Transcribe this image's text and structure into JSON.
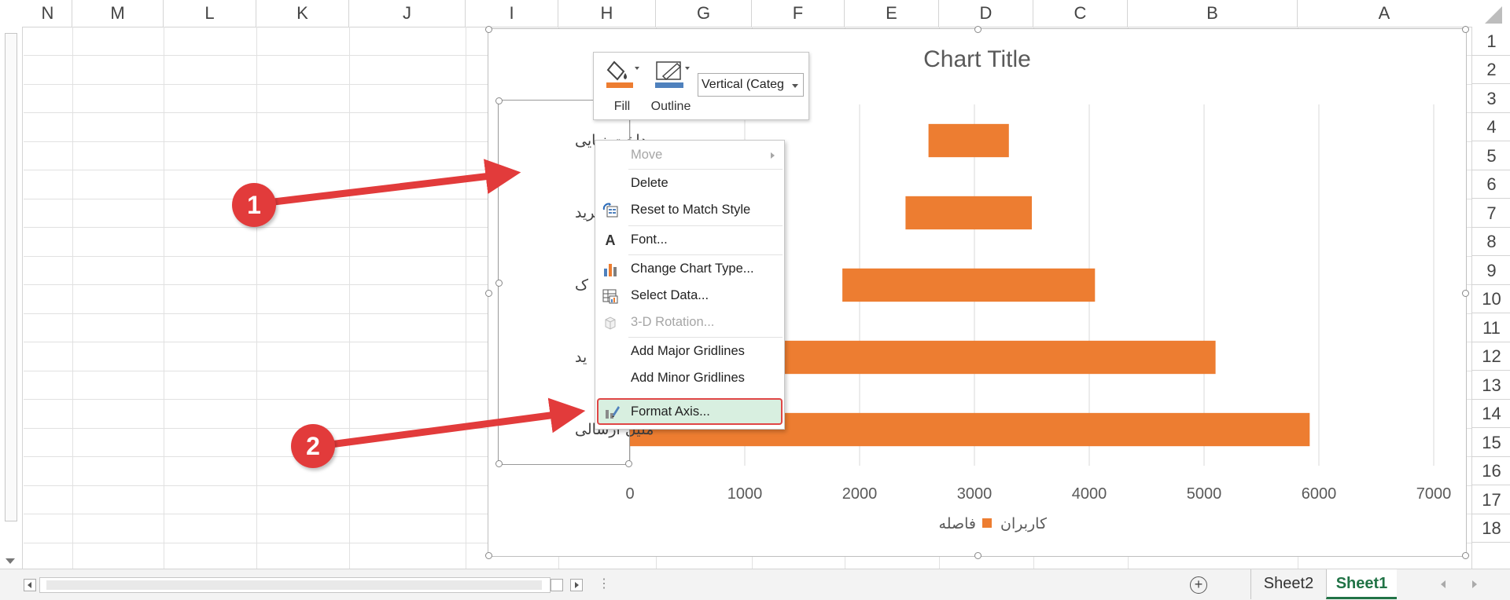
{
  "columns": [
    "N",
    "M",
    "L",
    "K",
    "J",
    "I",
    "H",
    "G",
    "F",
    "E",
    "D",
    "C",
    "B",
    "A"
  ],
  "rows": [
    "1",
    "2",
    "3",
    "4",
    "5",
    "6",
    "7",
    "8",
    "9",
    "10",
    "11",
    "12",
    "13",
    "14",
    "15",
    "16",
    "17",
    "18"
  ],
  "chart": {
    "title": "Chart Title",
    "legend": [
      {
        "label": "کاربران"
      },
      {
        "label": "فاصله"
      }
    ],
    "category_labels_visible": [
      "پرداخت نهایی",
      "ردن به سبد خرید",
      "ک",
      "ید",
      "ملیل ارسالی"
    ],
    "series_color": "#ed7d31"
  },
  "chart_data": {
    "type": "bar",
    "orientation": "horizontal",
    "stacked": true,
    "title": "Chart Title",
    "xlim": [
      0,
      7000
    ],
    "x_ticks": [
      0,
      1000,
      2000,
      3000,
      4000,
      5000,
      6000,
      7000
    ],
    "x_tick_labels": [
      "0",
      "1000",
      "2000",
      "3000",
      "4000",
      "5000",
      "6000",
      "7000"
    ],
    "grid": true,
    "legend_position": "bottom",
    "categories": [
      "پرداخت نهایی",
      "ردن به سبد خرید",
      "ک",
      "ید",
      "ملیل ارسالی"
    ],
    "series": [
      {
        "name": "فاصله",
        "values": [
          2600,
          2400,
          1850,
          1200,
          0
        ],
        "visible": false
      },
      {
        "name": "کاربران",
        "values": [
          700,
          1100,
          2200,
          3900,
          5920
        ]
      }
    ]
  },
  "mini_toolbar": {
    "fill_label": "Fill",
    "outline_label": "Outline",
    "selected_element": "Vertical (Categ"
  },
  "context_menu": {
    "items": [
      {
        "label": "Move",
        "disabled": true,
        "submenu": true
      },
      {
        "label": "Delete"
      },
      {
        "label": "Reset to Match Style"
      },
      {
        "label": "Font..."
      },
      {
        "label": "Change Chart Type..."
      },
      {
        "label": "Select Data..."
      },
      {
        "label": "3-D Rotation...",
        "disabled": true
      },
      {
        "label": "Add Major Gridlines"
      },
      {
        "label": "Add Minor Gridlines"
      },
      {
        "label": "Format Axis...",
        "highlighted": true
      }
    ]
  },
  "annotations": {
    "step1": "1",
    "step2": "2"
  },
  "sheets": {
    "tabs": [
      "Sheet2",
      "Sheet1"
    ],
    "active": "Sheet1"
  },
  "colors": {
    "excel_green": "#217346",
    "highlight_red": "#e04646",
    "bar_orange": "#ed7d31"
  }
}
